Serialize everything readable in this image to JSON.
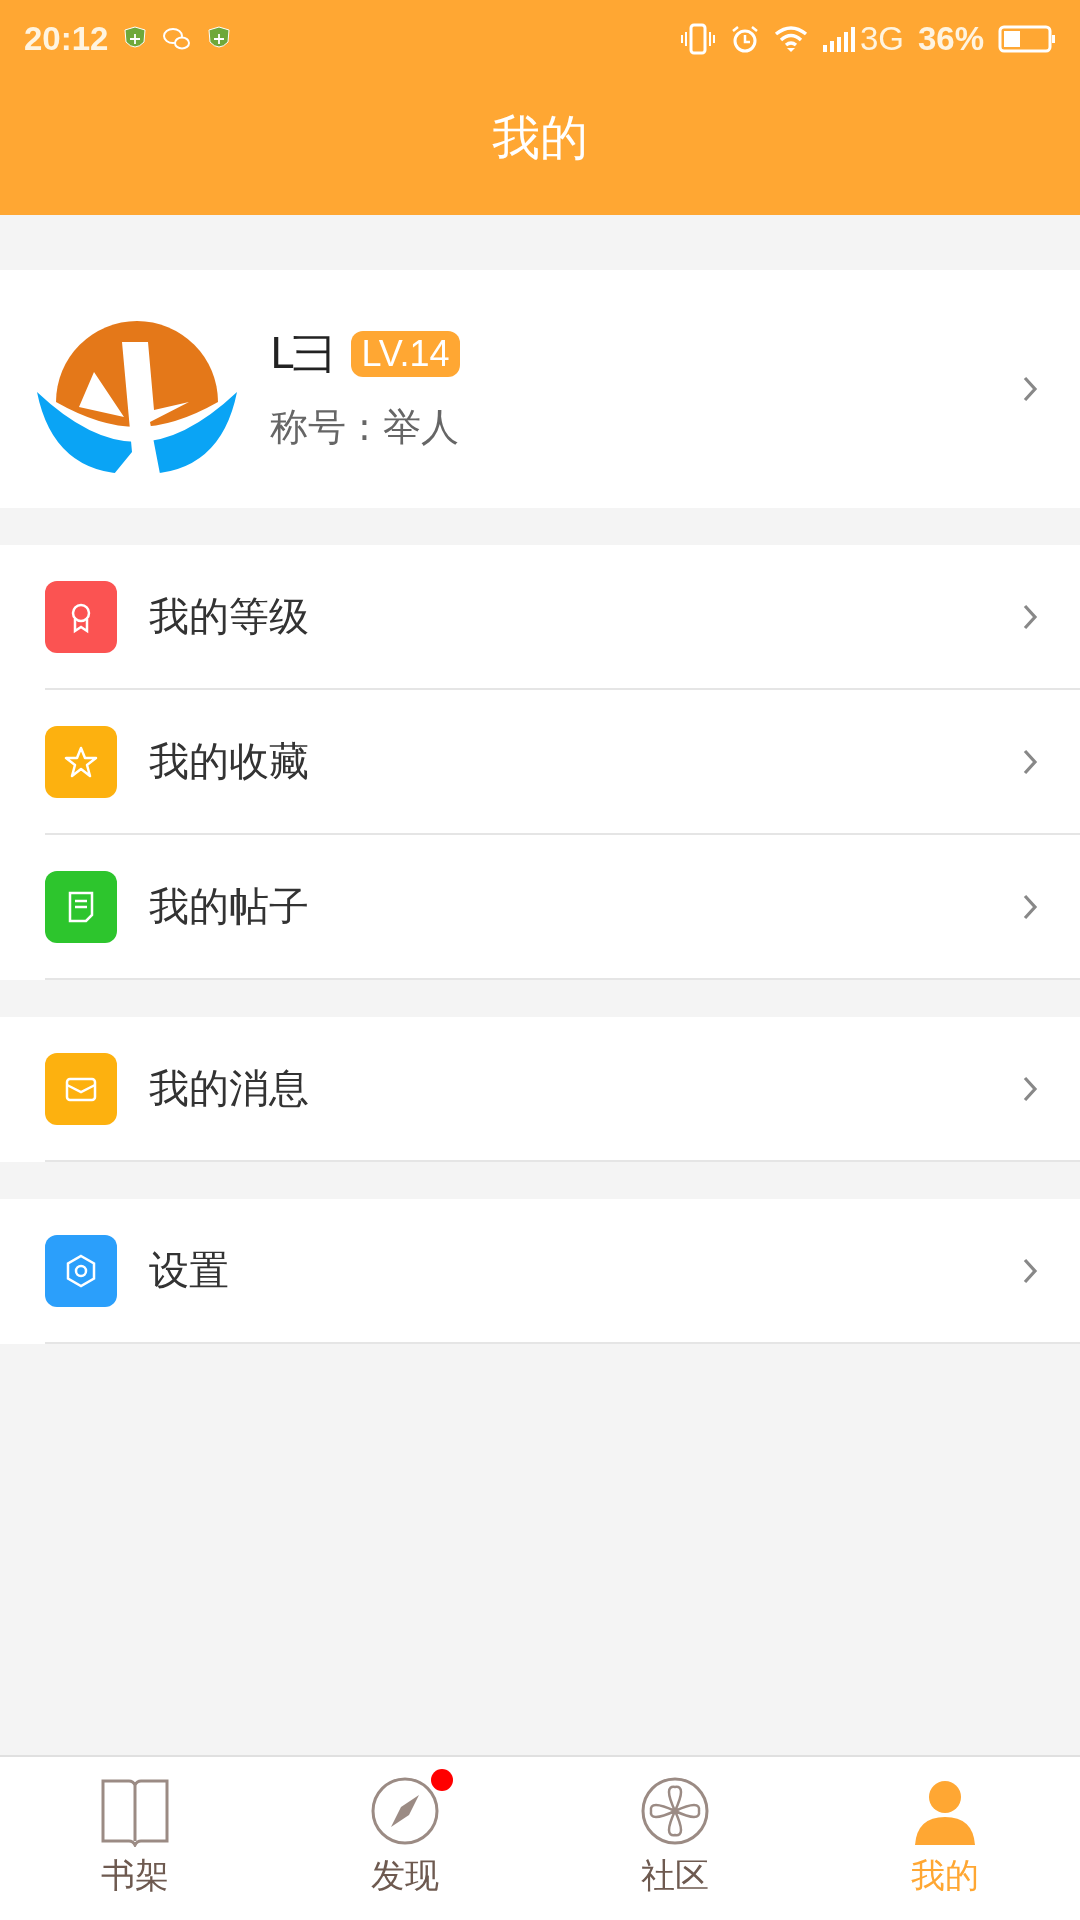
{
  "status_bar": {
    "time": "20:12",
    "network": "3G",
    "battery": "36%"
  },
  "header": {
    "title": "我的"
  },
  "profile": {
    "name": "L彐",
    "level_badge": "LV.14",
    "title_line": "称号 : 举人"
  },
  "menu_groups": [
    {
      "items": [
        {
          "label": "我的等级",
          "kind": "medal",
          "color": "#fb5352"
        },
        {
          "label": "我的收藏",
          "kind": "star",
          "color": "#fdb10f"
        },
        {
          "label": "我的帖子",
          "kind": "note",
          "color": "#2dc52d"
        }
      ]
    },
    {
      "items": [
        {
          "label": "我的消息",
          "kind": "mail",
          "color": "#fdb10f"
        }
      ]
    },
    {
      "items": [
        {
          "label": "设置",
          "kind": "hexagon",
          "color": "#2b9ffb"
        }
      ]
    }
  ],
  "bottom_nav": [
    {
      "label": "书架",
      "kind": "book",
      "selected": false,
      "badge": false
    },
    {
      "label": "发现",
      "kind": "compass",
      "selected": false,
      "badge": true
    },
    {
      "label": "社区",
      "kind": "flower",
      "selected": false,
      "badge": false
    },
    {
      "label": "我的",
      "kind": "person",
      "selected": true,
      "badge": false
    }
  ]
}
